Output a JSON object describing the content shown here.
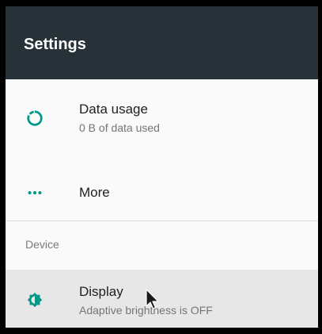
{
  "header": {
    "title": "Settings",
    "background_color": "#263238"
  },
  "settings": {
    "items": [
      {
        "title": "Data usage",
        "subtitle": "0 B of data used",
        "icon": "data-usage-icon"
      },
      {
        "title": "More",
        "icon": "more-horiz-icon"
      }
    ],
    "section": {
      "label": "Device"
    },
    "device_items": [
      {
        "title": "Display",
        "subtitle": "Adaptive brightness is OFF",
        "icon": "brightness-icon"
      }
    ]
  },
  "colors": {
    "accent": "#009688",
    "highlight_row": "#e7e7e7"
  },
  "cursor": {
    "icon": "mouse-pointer-icon"
  }
}
